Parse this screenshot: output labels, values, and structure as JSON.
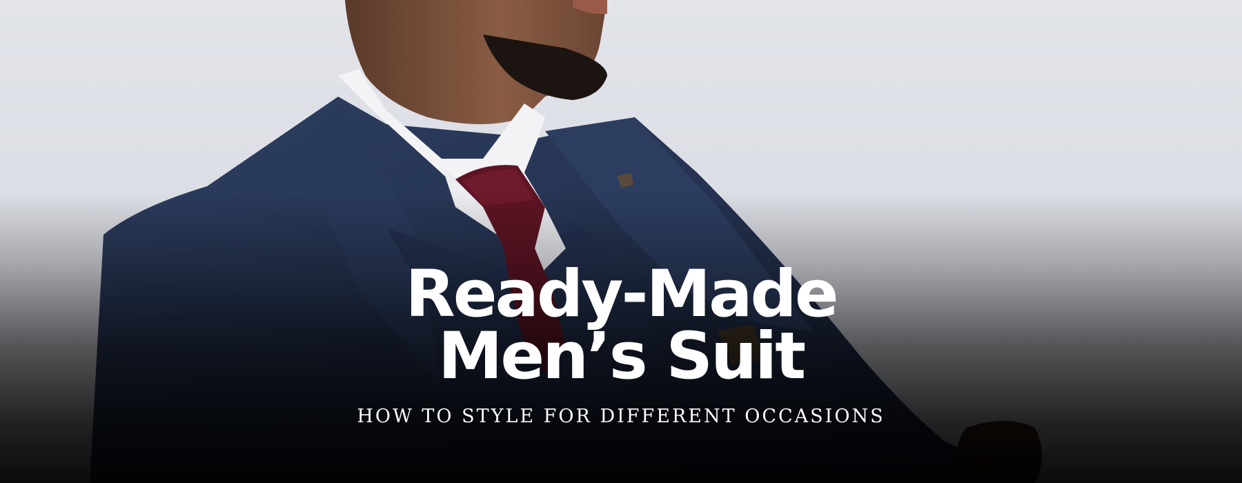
{
  "hero": {
    "title_line_1": "Ready-Made",
    "title_line_2": "Men’s Suit",
    "subtitle": "HOW TO STYLE FOR DIFFERENT OCCASIONS"
  },
  "colors": {
    "background": "#dfe1e8",
    "suit_navy": "#263552",
    "tie_burgundy": "#5e1424",
    "shirt_white": "#f4f4f6",
    "text": "#ffffff"
  }
}
